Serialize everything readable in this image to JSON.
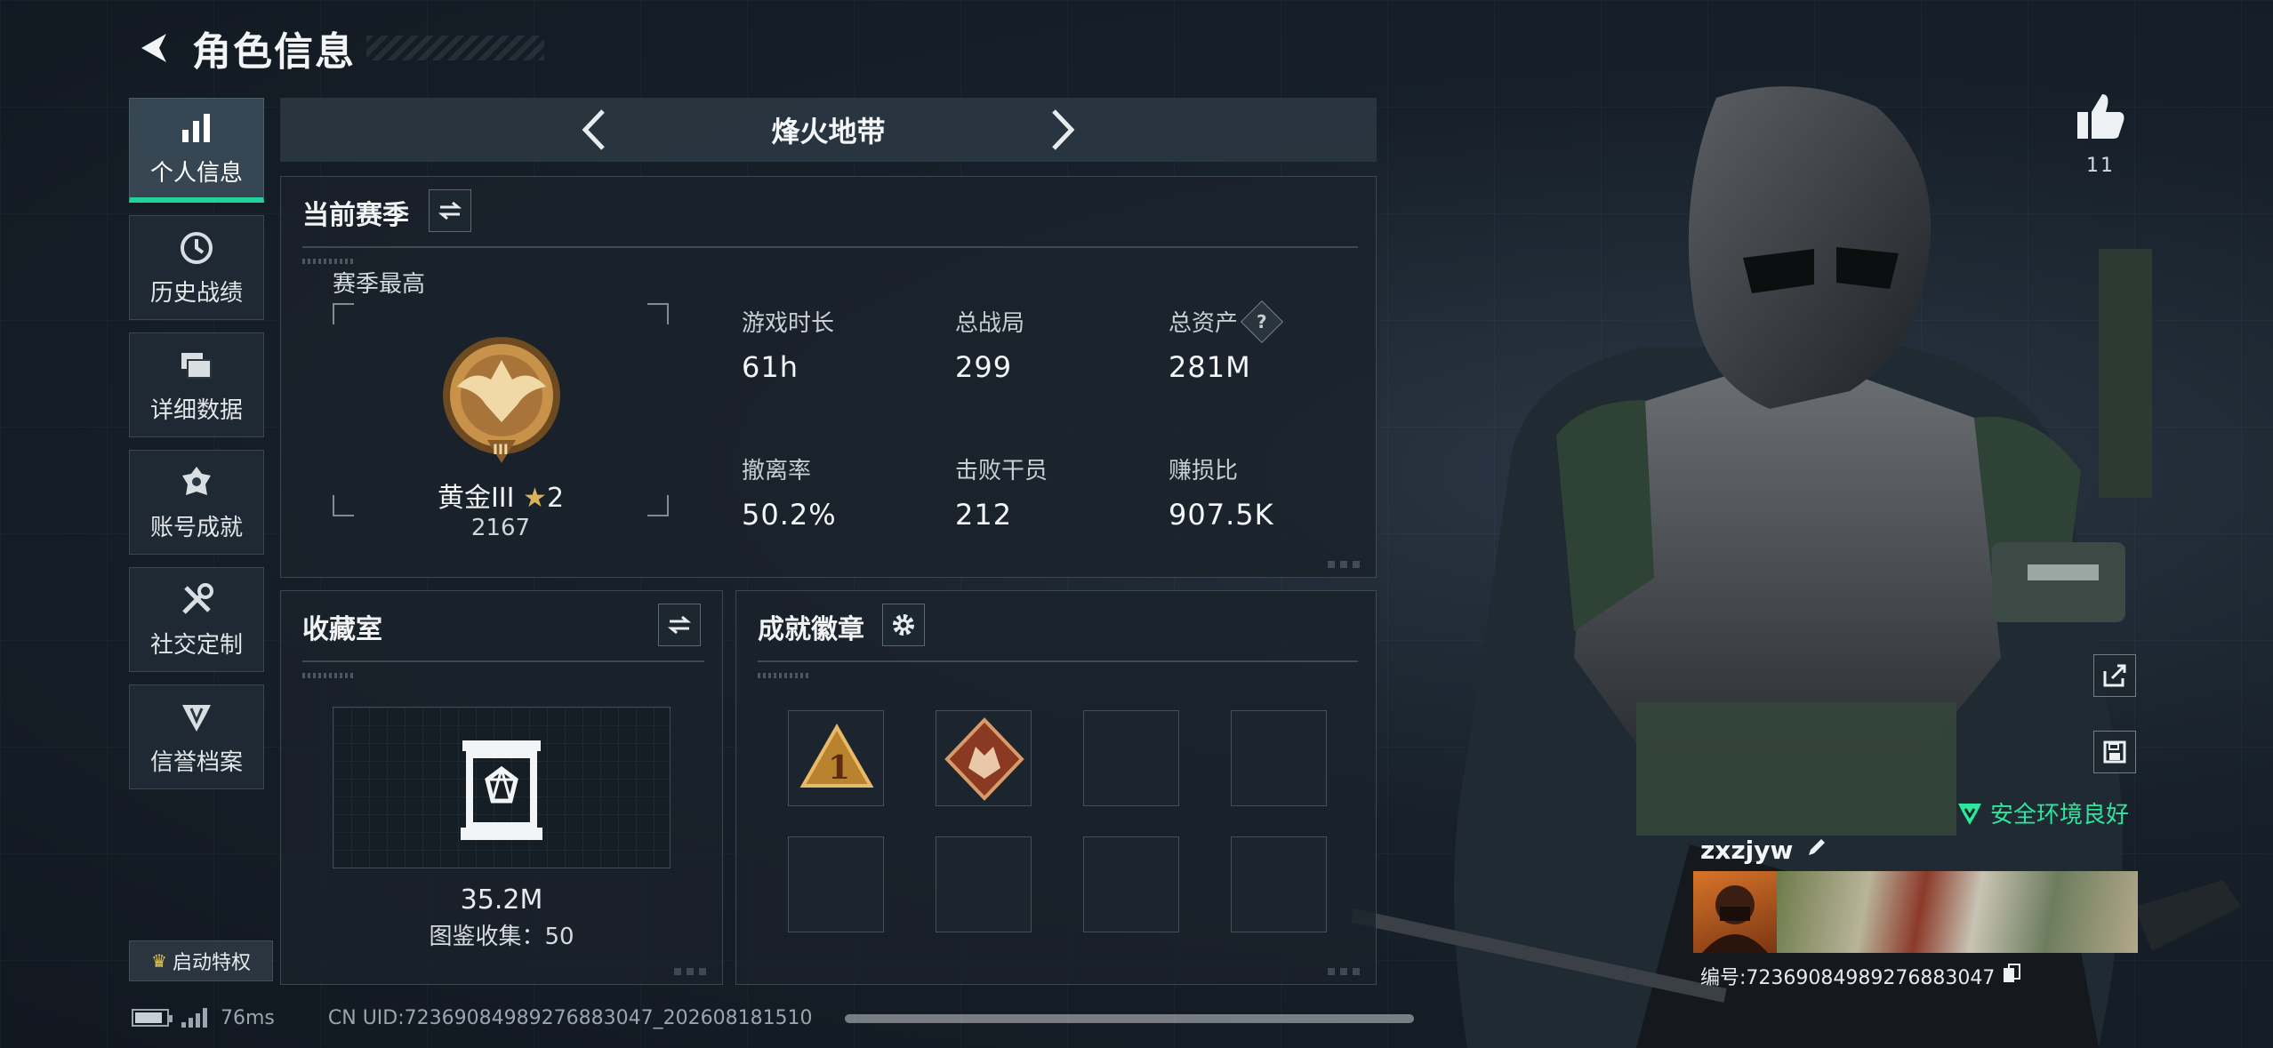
{
  "header": {
    "title": "角色信息"
  },
  "sidebar": {
    "items": [
      {
        "label": "个人信息",
        "icon": "bar-chart-icon",
        "active": true
      },
      {
        "label": "历史战绩",
        "icon": "history-clock-icon",
        "active": false
      },
      {
        "label": "详细数据",
        "icon": "folders-icon",
        "active": false
      },
      {
        "label": "账号成就",
        "icon": "achievement-medal-icon",
        "active": false
      },
      {
        "label": "社交定制",
        "icon": "tools-icon",
        "active": false
      },
      {
        "label": "信誉档案",
        "icon": "shield-wing-icon",
        "active": false
      }
    ],
    "privilege_label": "启动特权"
  },
  "mode": {
    "name": "烽火地带"
  },
  "season": {
    "title": "当前赛季",
    "best_label": "赛季最高",
    "rank_name": "黄金III",
    "rank_stars": "2",
    "rank_score": "2167",
    "stats": [
      {
        "label": "游戏时长",
        "value": "61h"
      },
      {
        "label": "总战局",
        "value": "299"
      },
      {
        "label": "总资产",
        "value": "281M",
        "help": "?"
      },
      {
        "label": "撤离率",
        "value": "50.2%"
      },
      {
        "label": "击败干员",
        "value": "212"
      },
      {
        "label": "赚损比",
        "value": "907.5K"
      }
    ]
  },
  "collection": {
    "title": "收藏室",
    "value": "35.2M",
    "count_text": "图鉴收集：50"
  },
  "badges": {
    "title": "成就徽章",
    "slots": [
      "rank-1-badge",
      "wolf-badge",
      "",
      "",
      "",
      "",
      "",
      ""
    ]
  },
  "profile": {
    "likes": "11",
    "safe_status": "安全环境良好",
    "username": "zxzjyw",
    "id_text": "编号:7236908498927688304​7"
  },
  "footer": {
    "latency": "76ms",
    "uid_text": "CN UID:7236908498927688304​7_20260818151​0"
  },
  "colors": {
    "accent": "#21d39a",
    "safe": "#2ee59d",
    "gold": "#d9b25a"
  }
}
